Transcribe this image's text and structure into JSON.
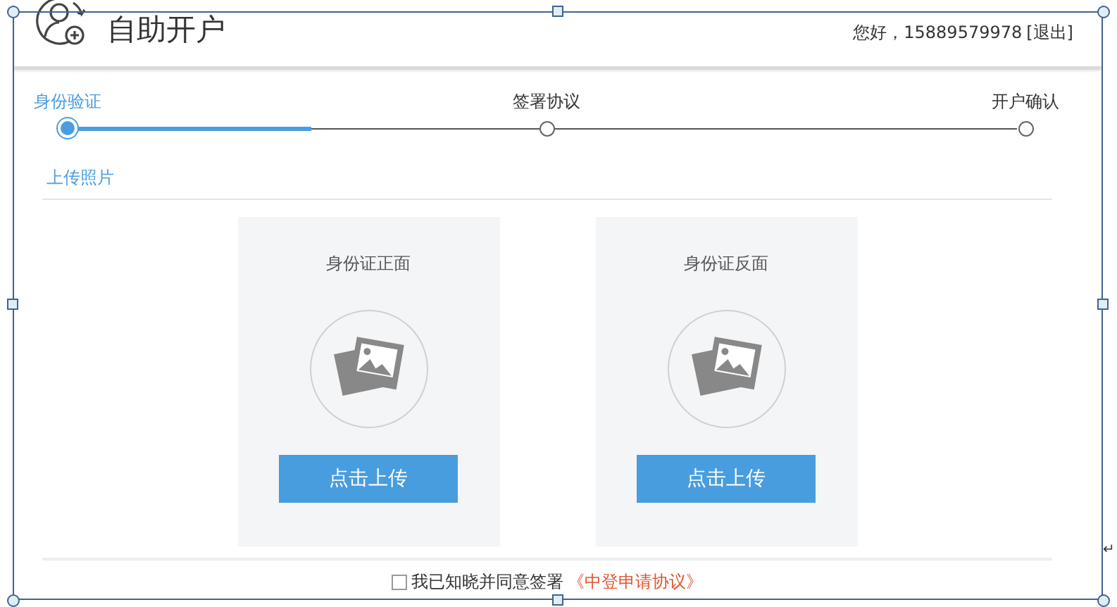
{
  "header": {
    "title": "自助开户",
    "greeting": "您好，15889579978",
    "logout": "[退出]"
  },
  "steps": {
    "level": 0.25,
    "items": [
      {
        "label": "身份验证",
        "selected": true
      },
      {
        "label": "签署协议",
        "selected": false
      },
      {
        "label": "开户确认",
        "selected": false
      }
    ]
  },
  "section_title": "上传照片",
  "upload_cards": [
    {
      "title": "身份证正面",
      "button": "点击上传"
    },
    {
      "title": "身份证反面",
      "button": "点击上传"
    }
  ],
  "agreement": {
    "checked": false,
    "text": "我已知晓并同意签署",
    "link": "《中登申请协议》"
  },
  "paragraph_mark": "↵"
}
